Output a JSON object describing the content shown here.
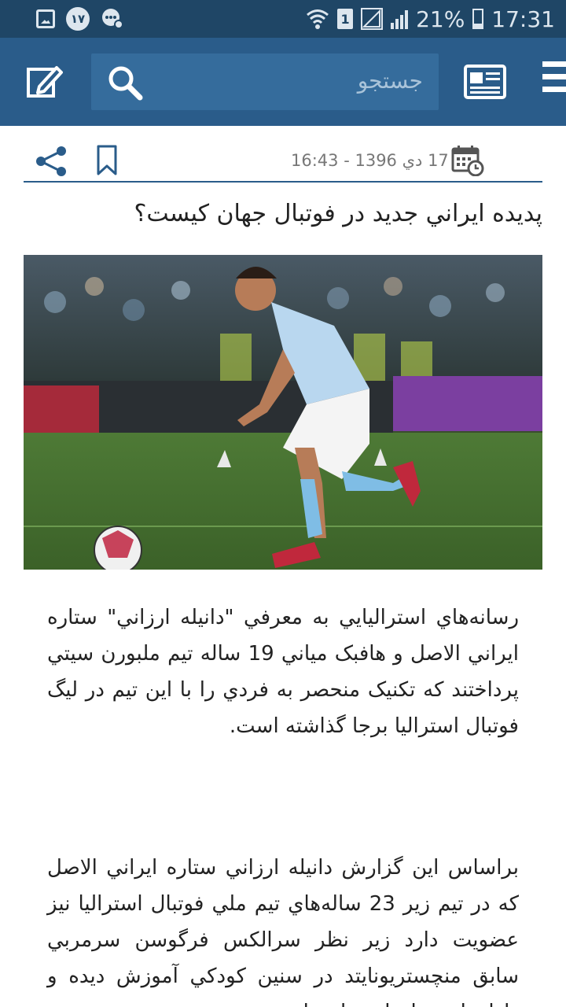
{
  "status_bar": {
    "notification_count": "۱۷",
    "sim_slot": "1",
    "battery": "21%",
    "time": "17:31"
  },
  "app_bar": {
    "search_placeholder": "جستجو"
  },
  "article": {
    "date": "17 دي 1396 - 16:43",
    "title": "پديده ايراني جديد در فوتبال جهان کيست؟",
    "paragraphs": [
      "رسانه‌هاي استراليايي به معرفي \"دانيله ارزاني\" ستاره ايراني الاصل و هافبک مياني 19 ساله تيم ملبورن سيتي پرداختند که تکنيک منحصر به فردي را با اين تيم در ليگ فوتبال استراليا برجا گذاشته است.",
      "براساس اين گزارش دانيله ارزاني ستاره ايراني الاصل که در تيم زير 23 ساله‌هاي تيم ملي فوتبال استراليا نيز عضويت دارد زير نظر سرالکس فرگوسن سرمربي سابق منچستريونايتد در سنين کودکي آموزش ديده و داراي استعدادهاي زيادي است."
    ]
  },
  "colors": {
    "status_bar_bg": "#1f4666",
    "app_bar_bg": "#2a5c8a",
    "search_bg": "#356c9c",
    "accent": "#2a5c8a"
  },
  "icons": {
    "edit": "edit-icon",
    "search": "search-icon",
    "news": "newspaper-icon",
    "menu": "menu-icon",
    "share": "share-icon",
    "bookmark": "bookmark-icon",
    "calendar": "calendar-clock-icon"
  }
}
